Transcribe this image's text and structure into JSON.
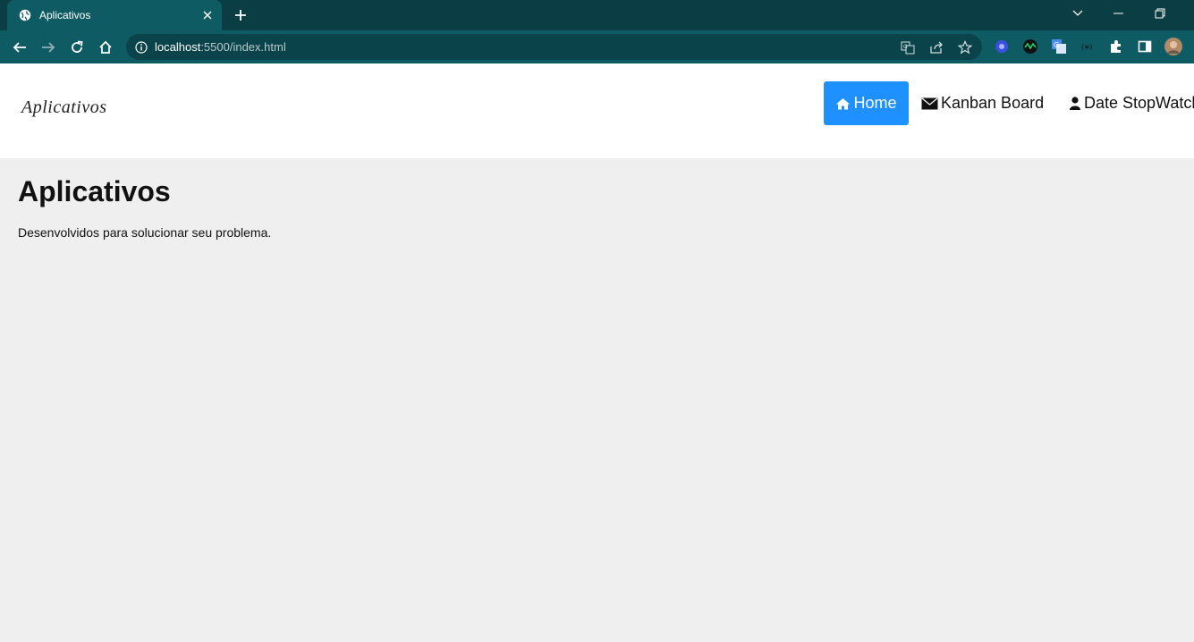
{
  "browser": {
    "tab_title": "Aplicativos",
    "url_host": "localhost",
    "url_rest": ":5500/index.html"
  },
  "icons": {
    "favicon": "globe-icon",
    "back": "back-arrow-icon",
    "forward": "forward-arrow-icon",
    "reload": "reload-icon",
    "home": "home-icon",
    "site_info": "info-icon",
    "translate": "translate-icon",
    "share": "share-icon",
    "bookmark": "star-icon",
    "extensions": "puzzle-icon",
    "side_panel": "side-panel-icon",
    "profile": "profile-avatar"
  },
  "site": {
    "logo": "Aplicativos",
    "nav": {
      "home": "Home",
      "kanban": "Kanban Board",
      "stopwatch": "Date StopWatch"
    }
  },
  "main": {
    "heading": "Aplicativos",
    "tagline": "Desenvolvidos para solucionar seu problema."
  },
  "colors": {
    "chrome_dark": "#0b3d45",
    "chrome_toolbar": "#0f5b63",
    "nav_active": "#1e90ff",
    "page_bg": "#efefef"
  }
}
